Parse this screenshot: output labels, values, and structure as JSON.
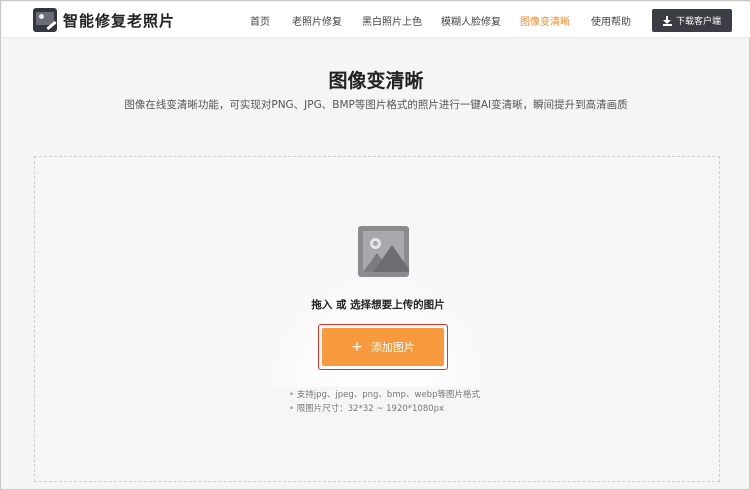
{
  "brand": {
    "name": "智能修复老照片"
  },
  "nav": {
    "items": [
      {
        "label": "首页"
      },
      {
        "label": "老照片修复"
      },
      {
        "label": "黑白照片上色"
      },
      {
        "label": "模糊人脸修复"
      },
      {
        "label": "图像变清晰"
      },
      {
        "label": "使用帮助"
      }
    ],
    "active": "图像变清晰",
    "download_label": "下载客户端"
  },
  "hero": {
    "title": "图像变清晰",
    "subtitle": "图像在线变清晰功能，可实现对PNG、JPG、BMP等图片格式的照片进行一键AI变清晰，瞬间提升到高清画质"
  },
  "upload": {
    "drop_text": "拖入 或 选择想要上传的图片",
    "add_label": "添加图片",
    "hints": [
      "支持jpg、jpeg、png、bmp、webp等图片格式",
      "限图片尺寸：32*32 ~ 1920*1080px"
    ]
  },
  "colors": {
    "accent": "#f18a2e",
    "button": "#f69a3d",
    "dark_button": "#3c3c44",
    "highlight_border": "#e0322a"
  },
  "icons": {
    "logo": "photo-wand-icon",
    "download": "download-icon",
    "upload_placeholder": "image-icon",
    "plus": "plus-icon"
  }
}
